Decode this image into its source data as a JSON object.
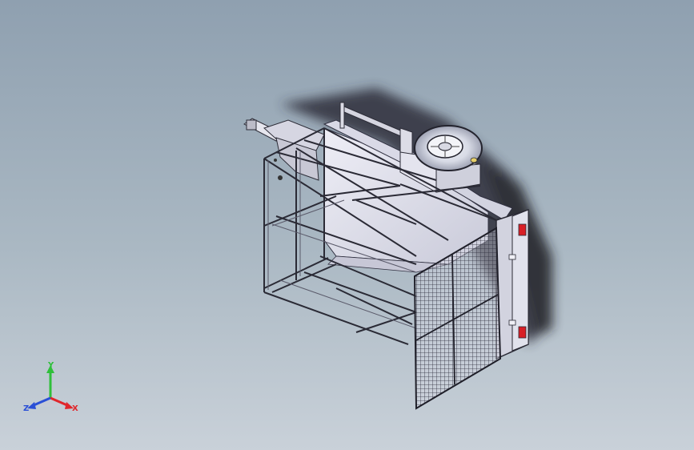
{
  "viewport": {
    "model": "cage trailer",
    "background_top": "#8fa0b0",
    "background_bottom": "#c9d1d9"
  },
  "triad": {
    "x_label": "X",
    "y_label": "Y",
    "z_label": "Z",
    "x_color": "#e0262b",
    "y_color": "#2fbf3a",
    "z_color": "#2a4fd6"
  }
}
